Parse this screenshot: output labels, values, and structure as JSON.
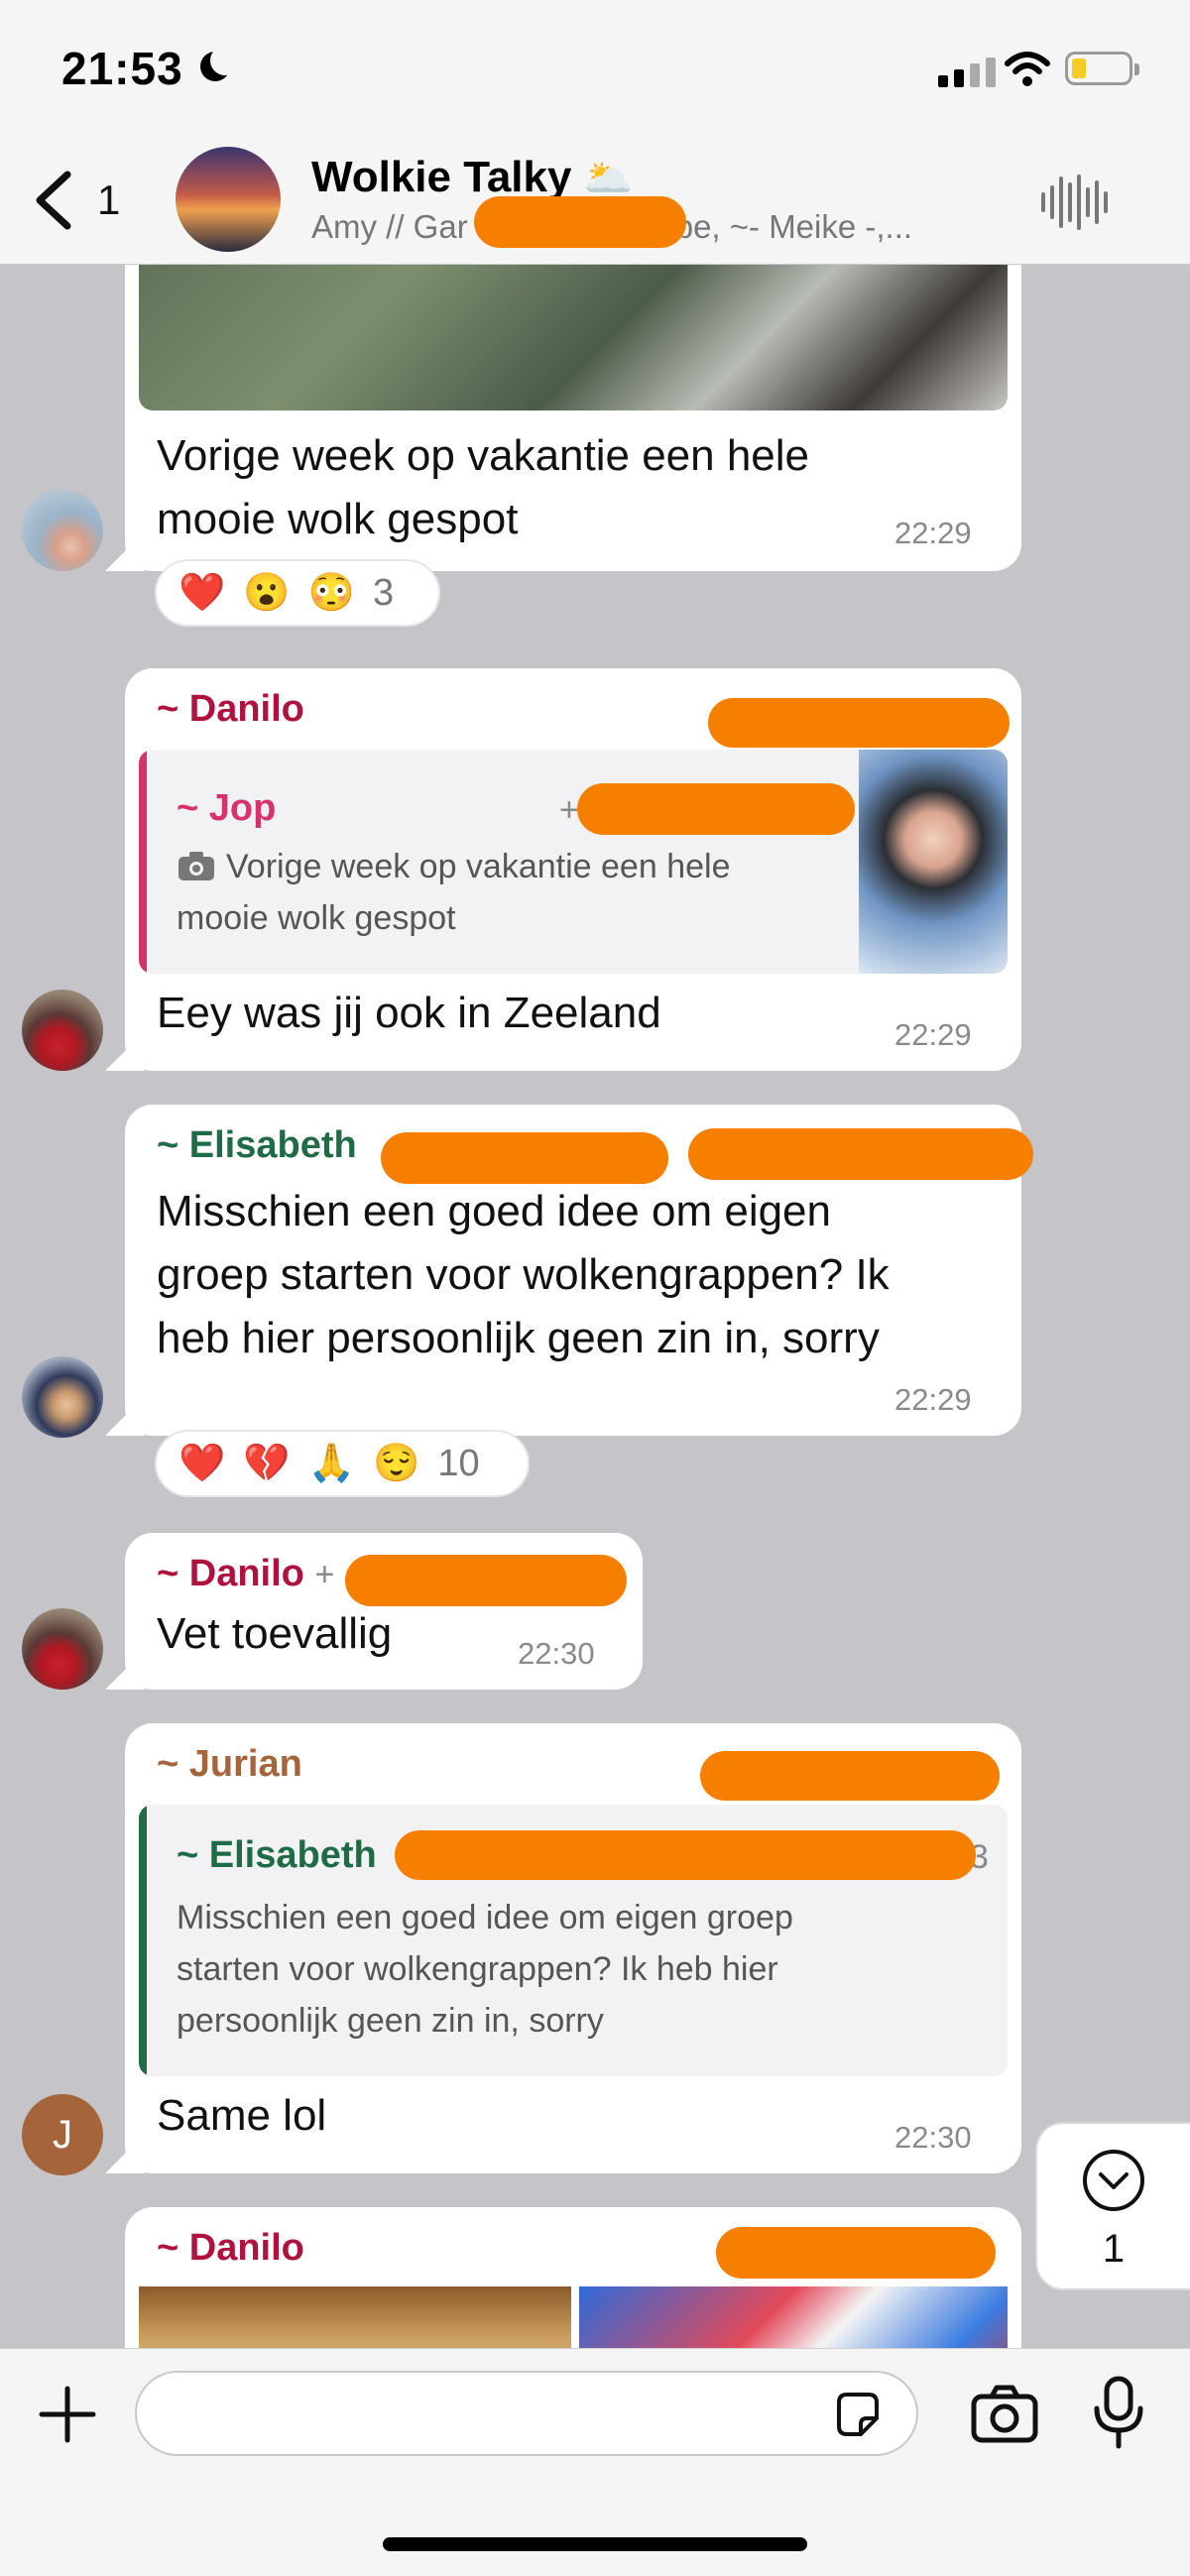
{
  "status_bar": {
    "time": "21:53"
  },
  "header": {
    "back_count": "1",
    "title": "Wolkie Talky",
    "title_emoji": "🌥️",
    "subtitle": "Amy // Gar                  , Tibe, ~- Meike -,..."
  },
  "messages": [
    {
      "text": "Vorige week op vakantie een hele\nmooie wolk gespot",
      "time": "22:29",
      "reactions": [
        "❤️",
        "😮",
        "😳"
      ],
      "reaction_count": "3"
    },
    {
      "sender": "~ Danilo",
      "quote_sender": "~ Jop",
      "quote_prefix": "+",
      "quote_text": "Vorige week op vakantie een hele mooie wolk gespot",
      "text": "Eey was jij ook in Zeeland",
      "time": "22:29"
    },
    {
      "sender": "~ Elisabeth",
      "text": "Misschien een goed idee om eigen\ngroep starten voor wolkengrappen? Ik\nheb hier persoonlijk geen zin in, sorry",
      "time": "22:29",
      "reactions": [
        "❤️",
        "💔",
        "🙏",
        "😌"
      ],
      "reaction_count": "10"
    },
    {
      "sender": "~ Danilo",
      "sender_suffix": "+",
      "text": "Vet toevallig",
      "time": "22:30"
    },
    {
      "sender": "~ Jurian",
      "quote_sender": "~ Elisabeth",
      "quote_tail": "3",
      "quote_text": "Misschien een goed idee om eigen groep\nstarten voor wolkengrappen? Ik heb hier\npersoonlijk geen zin in, sorry",
      "text": "Same lol",
      "time": "22:30",
      "avatar_letter": "J"
    },
    {
      "sender": "~ Danilo"
    }
  ],
  "scroll_down": {
    "count": "1"
  },
  "colors": {
    "danilo": "#b0123e",
    "jop": "#d6336c",
    "elisabeth": "#1e6b46",
    "jurian": "#a5643a",
    "redaction": "#f77f00",
    "chat_bg": "#c4c4c9"
  }
}
